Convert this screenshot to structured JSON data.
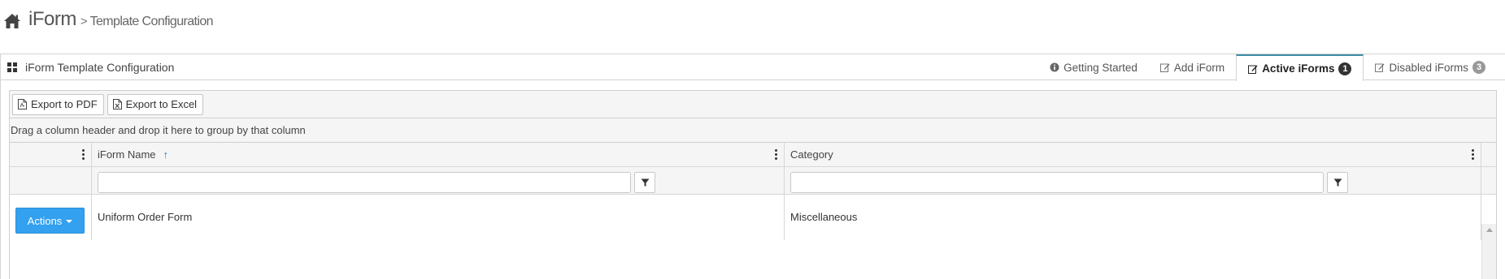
{
  "header": {
    "app_title": "iForm",
    "separator": ">",
    "breadcrumb": "Template Configuration"
  },
  "portlet": {
    "caption": "iForm Template Configuration",
    "tabs": [
      {
        "label": "Getting Started",
        "icon": "info-circle-icon",
        "active": false
      },
      {
        "label": "Add iForm",
        "icon": "edit-icon",
        "active": false
      },
      {
        "label": "Active iForms",
        "icon": "edit-icon",
        "active": true,
        "badge": "1"
      },
      {
        "label": "Disabled iForms",
        "icon": "edit-icon",
        "active": false,
        "badge": "3"
      }
    ]
  },
  "toolbar": {
    "export_pdf": "Export to PDF",
    "export_excel": "Export to Excel"
  },
  "grid": {
    "group_hint": "Drag a column header and drop it here to group by that column",
    "columns": {
      "name": "iForm Name",
      "category": "Category"
    },
    "sort": {
      "column": "iForm Name",
      "direction": "ascending"
    },
    "filters": {
      "name": "",
      "category": ""
    },
    "rows": [
      {
        "actions_label": "Actions",
        "name": "Uniform Order Form",
        "category": "Miscellaneous"
      }
    ]
  },
  "colors": {
    "accent_tab": "#3e8ca5",
    "actions_button": "#33a0f0",
    "sort_arrow": "#2a7bd0"
  }
}
